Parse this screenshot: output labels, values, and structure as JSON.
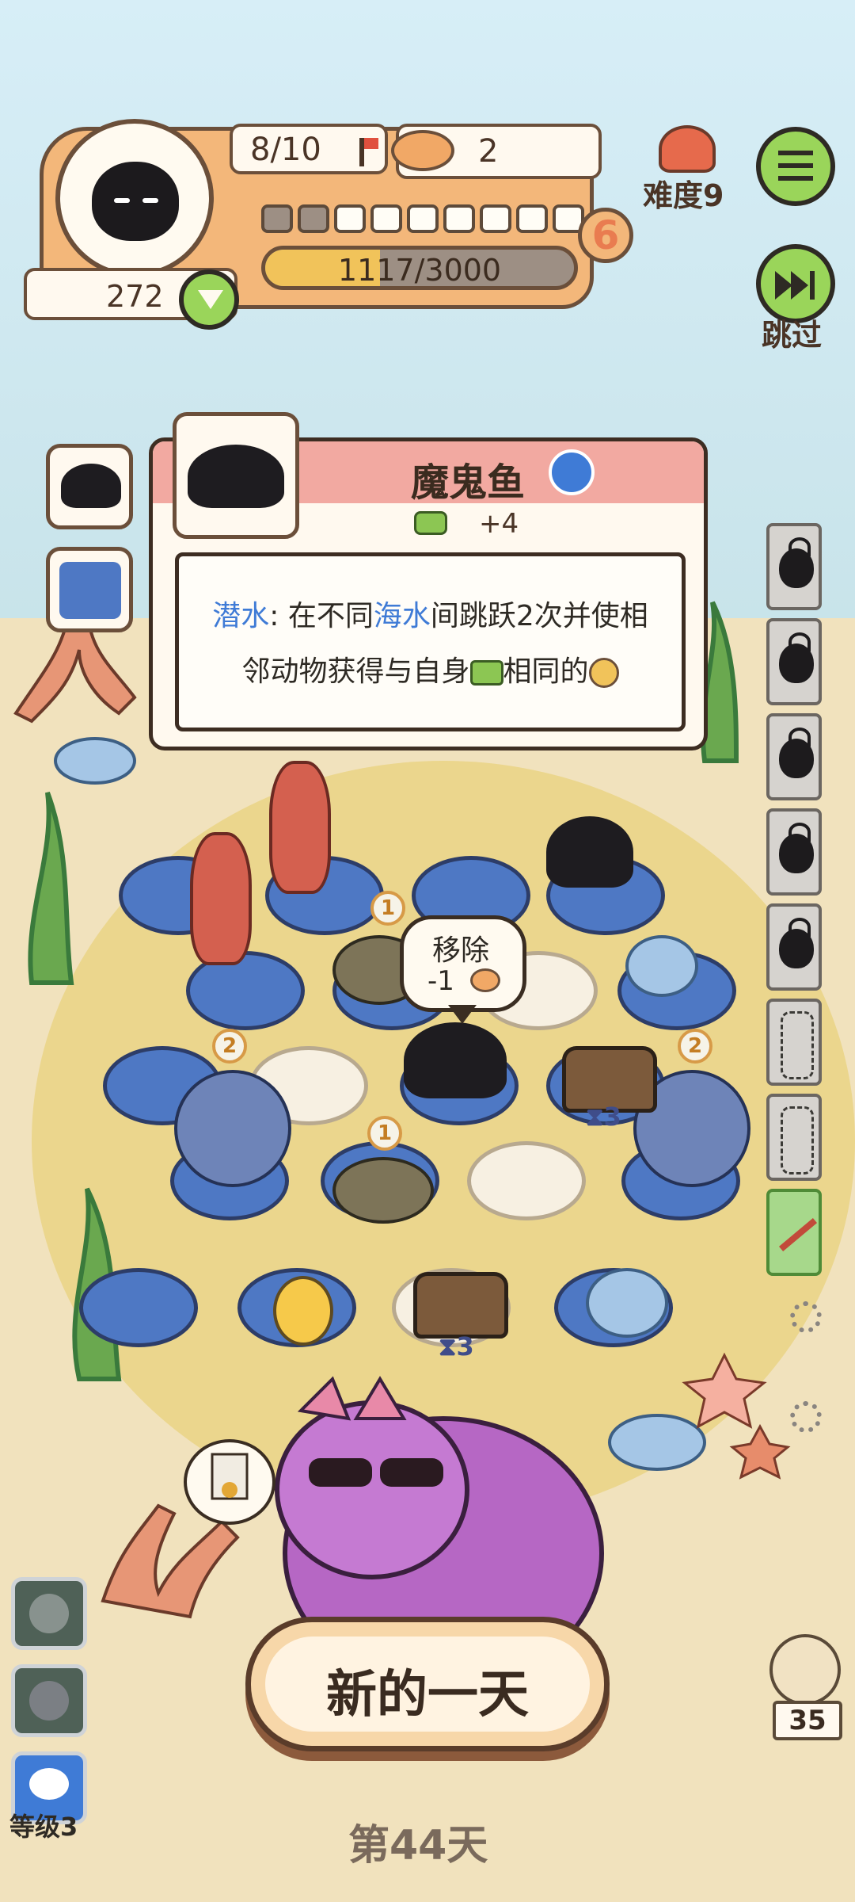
{
  "player": {
    "ticket_progress": "8/10",
    "coins": "272",
    "cans": "2",
    "level_number": "6",
    "xp": "1117/3000",
    "segments_filled": 2,
    "segments_total": 9
  },
  "header": {
    "difficulty_label": "难度9",
    "skip_label": "跳过"
  },
  "tooltip": {
    "name": "魔鬼鱼",
    "bonus": "+4",
    "ability_keyword": "潜水",
    "desc_part1": ": 在不同",
    "desc_keyword2": "海水",
    "desc_part2": "间跳跃2次并使相",
    "desc_line2": "邻动物获得与自身",
    "desc_line2_tail": "相同的"
  },
  "remove_bubble": {
    "label": "移除",
    "cost": "-1"
  },
  "board": {
    "badge_1a": "1",
    "badge_1b": "1",
    "badge_2a": "2",
    "badge_2b": "2",
    "chest_timer_a": "3",
    "chest_timer_b": "3"
  },
  "footer": {
    "new_day_label": "新的一天",
    "day_label": "第44天",
    "level_label": "等级3",
    "fish_count": "35"
  },
  "colors": {
    "accent_orange": "#f3b77a",
    "keyword_blue": "#3f7bd6",
    "button_green": "#9ad55a",
    "header_pink": "#f2a9a1"
  }
}
